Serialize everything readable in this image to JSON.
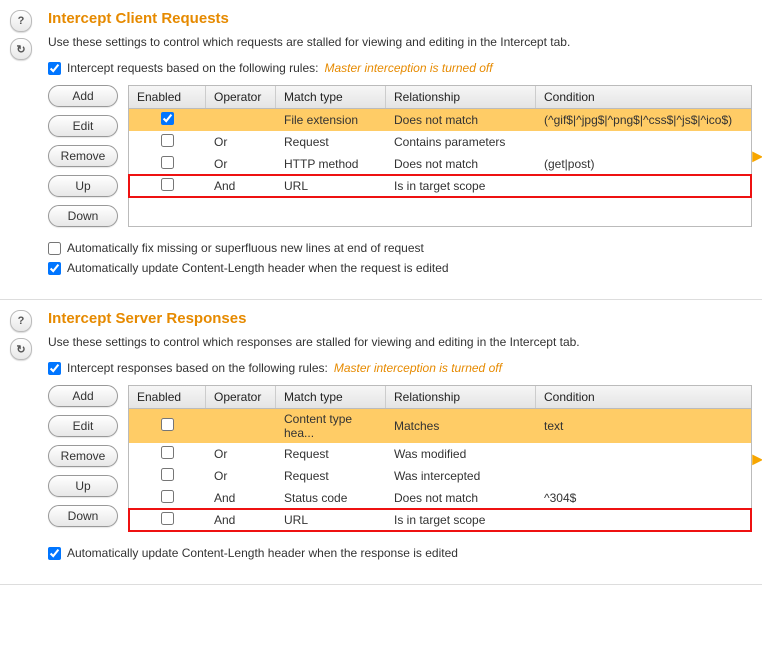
{
  "sections": {
    "req": {
      "title": "Intercept Client Requests",
      "desc": "Use these settings to control which requests are stalled for viewing and editing in the Intercept tab.",
      "rules_label": "Intercept requests based on the following rules:",
      "rules_note": "Master interception is turned off",
      "headers": [
        "Enabled",
        "Operator",
        "Match type",
        "Relationship",
        "Condition"
      ],
      "rows": [
        {
          "enabled": true,
          "op": "",
          "match": "File extension",
          "rel": "Does not match",
          "cond": "(^gif$|^jpg$|^png$|^css$|^js$|^ico$)",
          "sel": true
        },
        {
          "enabled": false,
          "op": "Or",
          "match": "Request",
          "rel": "Contains parameters",
          "cond": ""
        },
        {
          "enabled": false,
          "op": "Or",
          "match": "HTTP method",
          "rel": "Does not match",
          "cond": "(get|post)"
        },
        {
          "enabled": false,
          "op": "And",
          "match": "URL",
          "rel": "Is in target scope",
          "cond": "",
          "hl": true
        }
      ],
      "checks": [
        {
          "label": "Automatically fix missing or superfluous new lines at end of request",
          "checked": false
        },
        {
          "label": "Automatically update Content-Length header when the request is edited",
          "checked": true
        }
      ]
    },
    "res": {
      "title": "Intercept Server Responses",
      "desc": "Use these settings to control which responses are stalled for viewing and editing in the Intercept tab.",
      "rules_label": "Intercept responses based on the following rules:",
      "rules_note": "Master interception is turned off",
      "headers": [
        "Enabled",
        "Operator",
        "Match type",
        "Relationship",
        "Condition"
      ],
      "rows": [
        {
          "enabled": false,
          "op": "",
          "match": "Content type hea...",
          "rel": "Matches",
          "cond": "text",
          "sel": true
        },
        {
          "enabled": false,
          "op": "Or",
          "match": "Request",
          "rel": "Was modified",
          "cond": ""
        },
        {
          "enabled": false,
          "op": "Or",
          "match": "Request",
          "rel": "Was intercepted",
          "cond": ""
        },
        {
          "enabled": false,
          "op": "And",
          "match": "Status code",
          "rel": "Does not match",
          "cond": "^304$"
        },
        {
          "enabled": false,
          "op": "And",
          "match": "URL",
          "rel": "Is in target scope",
          "cond": "",
          "hl": true
        }
      ],
      "checks": [
        {
          "label": "Automatically update Content-Length header when the response is edited",
          "checked": true
        }
      ]
    }
  },
  "buttons": {
    "add": "Add",
    "edit": "Edit",
    "remove": "Remove",
    "up": "Up",
    "down": "Down"
  }
}
